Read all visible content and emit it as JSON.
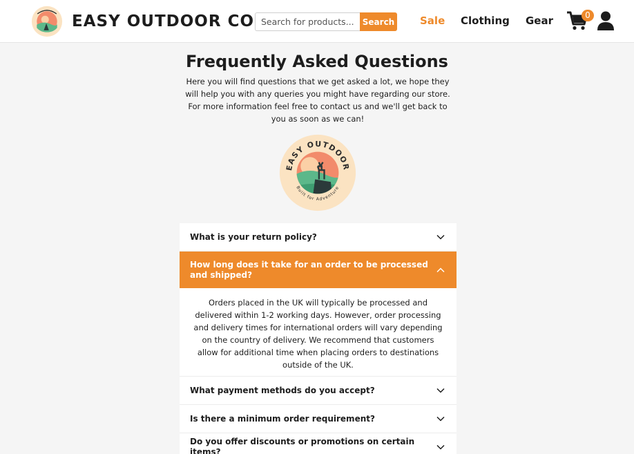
{
  "header": {
    "brand": "EASY OUTDOOR CO.",
    "search": {
      "placeholder": "Search for products...",
      "button_label": "Search"
    },
    "nav": {
      "sale": "Sale",
      "clothing": "Clothing",
      "gear": "Gear"
    },
    "cart_count": "0",
    "icons": [
      "cart-icon",
      "account-icon"
    ]
  },
  "logo": {
    "top_text": "EASY OUTDOOR",
    "bottom_text": "Built for Adventure"
  },
  "main": {
    "title": "Frequently Asked Questions",
    "intro": "Here you will find questions that we get asked a lot, we hope they will help you with any queries you might have regarding our store. For more information feel free to contact us and we'll get back to you as soon as we can!"
  },
  "faq": [
    {
      "question": "What is your return policy?"
    },
    {
      "question": "How long does it take for an order to be processed and shipped?",
      "answer": "Orders placed in the UK will typically be processed and delivered within 1-2 working days. However, order processing and delivery times for international orders will vary depending on the country of delivery. We recommend that customers allow for additional time when placing orders to destinations outside of the UK."
    },
    {
      "question": "What payment methods do you accept?"
    },
    {
      "question": "Is there a minimum order requirement?"
    },
    {
      "question": "Do you offer discounts or promotions on certain items?"
    }
  ],
  "colors": {
    "accent": "#ee8a2b",
    "text": "#1d1d1d",
    "background": "#f5f5f5"
  }
}
